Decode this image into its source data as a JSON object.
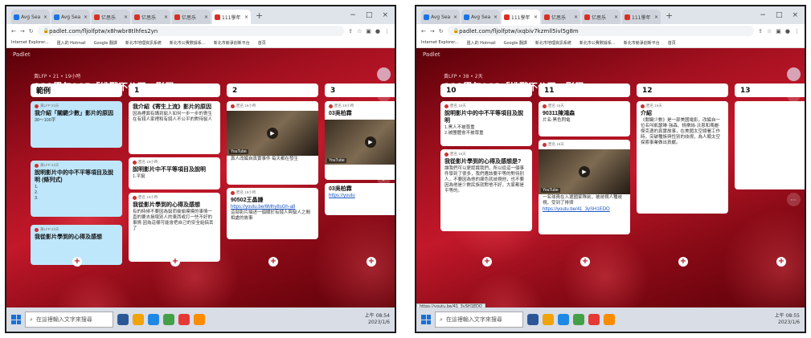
{
  "frames": [
    {
      "tabs": [
        {
          "label": "Avg Sea",
          "color": "#1a73e8"
        },
        {
          "label": "Avg Sea",
          "color": "#1a73e8"
        },
        {
          "label": "亿思乐",
          "color": "#d93025"
        },
        {
          "label": "亿思乐",
          "color": "#d93025"
        },
        {
          "label": "亿思乐",
          "color": "#d93025"
        },
        {
          "label": "111學年",
          "color": "#d93025",
          "active": true
        }
      ],
      "url": "padlet.com/fljolfptw/x8hwbr8tlhfes2yn",
      "bookmarks": [
        "Internet Explorer...",
        "匯入的 Hotmail",
        "Google 翻譯",
        "新北市地理資訊系統",
        "新北市公費數據系...",
        "新北市競爭創新平台",
        "首頁"
      ],
      "brand": "Padlet",
      "meta": "黃LFP • 21 • 19小時",
      "title": "111學年905「挑戰不公平」影展",
      "columns": [
        {
          "name": "範例",
          "cards": [
            {
              "author": "黃LFP 23天",
              "title": "我介紹「關鍵少數」影片的原因",
              "body": "30～100字",
              "blue": true
            },
            {
              "author": "黃LFP 23天",
              "title": "說明影片中的中不平等項目及說明 (條列式)",
              "body": "1.\n2.\n3.",
              "blue": true
            },
            {
              "author": "黃LFP 23天",
              "title": "我從影片學到的心得及感想",
              "body": "",
              "blue": true
            }
          ]
        },
        {
          "name": "1",
          "cards": [
            {
              "author": "",
              "title": "我介紹《寄生上流》影片的原因",
              "body": "因為裡面有講到窮人如何一步一步的寄生在有錢人家裡和有錢人不公平的對待窮人"
            },
            {
              "author": "匿名 19小時",
              "title": "說明影片中不平等項目及說明",
              "body": "1.平窮"
            },
            {
              "author": "匿名 19小時",
              "title": "我從影片學到的心得及感想",
              "body": "有的時候不要因為窮而偷偷摸摸的事情一直的要去損壞別人的東西或打一些不好的事情 因為這樣可能會把自己的安全給搞丟了"
            }
          ]
        },
        {
          "name": "2",
          "cards": [
            {
              "author": "匿名 19小時",
              "title": "",
              "body": "",
              "video": true,
              "yt": "YouTube",
              "caption": "真人改編自真實事件 每天都在發生"
            },
            {
              "author": "匿名 19小時",
              "title": "90502王晶謙",
              "body": "",
              "link": "https://youtu.be/6Mhy8sGh-a8",
              "caption2": "這部影片描述一個關於有錢人與窮人之間相處的故事"
            }
          ]
        },
        {
          "name": "3",
          "cards": [
            {
              "author": "匿名 19小時",
              "title": "03吳柏霖",
              "body": "",
              "video": true,
              "yt": "YouTube"
            },
            {
              "author": "",
              "title": "03吳柏霖",
              "body": "",
              "link": "https://youtu"
            }
          ]
        }
      ],
      "status": "",
      "search": "在這裡輸入文字來搜尋",
      "tray": "上午 08:54\n2023/1/6"
    },
    {
      "tabs": [
        {
          "label": "Avg Sea",
          "color": "#1a73e8"
        },
        {
          "label": "Avg Sea",
          "color": "#1a73e8"
        },
        {
          "label": "111學年",
          "color": "#d93025",
          "active": true
        },
        {
          "label": "亿思乐",
          "color": "#d93025"
        },
        {
          "label": "亿思乐",
          "color": "#d93025"
        },
        {
          "label": "111學年",
          "color": "#d93025"
        }
      ],
      "url": "padlet.com/fljolfptw/ixqbiv7kzmll5ivl5g8m",
      "bookmarks": [
        "Internet Explorer...",
        "匯入的 Hotmail",
        "Google 翻譯",
        "新北市地理資訊系統",
        "新北市公費數據系...",
        "新北市競爭創新平台",
        "首頁"
      ],
      "brand": "Padlet",
      "meta": "黃LFP • 38 • 2天",
      "title": "111學年903「挑戰不公平」影展",
      "columns": [
        {
          "name": "10",
          "cards": [
            {
              "author": "匿名 16天",
              "title": "說明影片中的中不平等項目及說明",
              "body": "1.黑人不被尊重\n2.被團體會不被尊重"
            },
            {
              "author": "匿名 16天",
              "title": "我從影片學到的心得及感想是?",
              "body": "讓我們可以更認識我們，所以從這一個事件學到了很多，我們應該要平等的對待別人，不要因為他的膚色就歧視他，也不要因為他是少數民族就對他不好，大家都是平等的。"
            }
          ]
        },
        {
          "name": "11",
          "cards": [
            {
              "author": "匿名 16天",
              "title": "90311陳鴻森",
              "body": "片名:黑色閃電"
            },
            {
              "author": "匿名 16天",
              "title": "",
              "body": "",
              "video": true,
              "yt": "YouTube",
              "caption": "一名球員在入選國家隊前，被歧視人種歧視，受到了排擠",
              "link": "https://youtu.be/41_3ySH1EDO"
            }
          ]
        },
        {
          "name": "12",
          "cards": [
            {
              "author": "匿名 16天",
              "title": "介紹",
              "body": "《關鍵少數》是一部美國電影，改編自一位名叫凱瑟琳·強森、桃樂絲·沃恩和瑪麗·傑克遜的真實故事，在美國太空總署工作時，突破種族與性別的歧視，為人類太空探索事業做出貢獻。"
            }
          ]
        },
        {
          "name": "13",
          "cards": [
            {
              "author": "",
              "title": "",
              "body": "",
              "video": false
            }
          ]
        }
      ],
      "status": "https://youtu.be/41_3ySH1EDO",
      "search": "在這裡輸入文字來搜尋",
      "tray": "上午 08:55\n2023/1/6"
    }
  ]
}
